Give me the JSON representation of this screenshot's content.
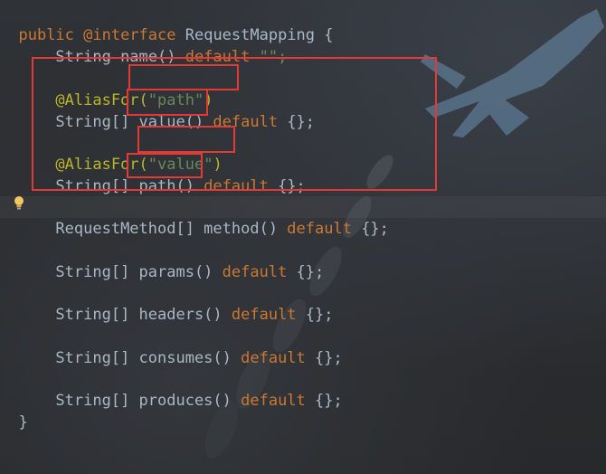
{
  "icons": {
    "gutter": "lightbulb-icon",
    "background": "jet-aircraft-wallpaper"
  },
  "colors": {
    "keyword": "#cc7832",
    "annotation": "#bbb529",
    "string": "#6a8759",
    "text": "#a9b7c6",
    "highlight_box": "#e53935"
  },
  "code": {
    "line1": [
      "public ",
      "@interface",
      " RequestMapping {"
    ],
    "line2": [
      "    String name() ",
      "default",
      " \"\";"
    ],
    "line3": [
      "    @AliasFor(",
      "\"path\"",
      ")"
    ],
    "line4": [
      "    String[] value() ",
      "default",
      " {};"
    ],
    "line5": [
      "    @AliasFor(",
      "\"value\"",
      ")"
    ],
    "line6": [
      "    String[] path() ",
      "default",
      " {};"
    ],
    "line7": [
      "    RequestMethod[] method() ",
      "default",
      " {};"
    ],
    "line8": [
      "    String[] params() ",
      "default",
      " {};"
    ],
    "line9": [
      "    String[] headers() ",
      "default",
      " {};"
    ],
    "line10": [
      "    String[] consumes() ",
      "default",
      " {};"
    ],
    "line11": [
      "    String[] produces() ",
      "default",
      " {};"
    ],
    "line12": [
      "}"
    ]
  }
}
